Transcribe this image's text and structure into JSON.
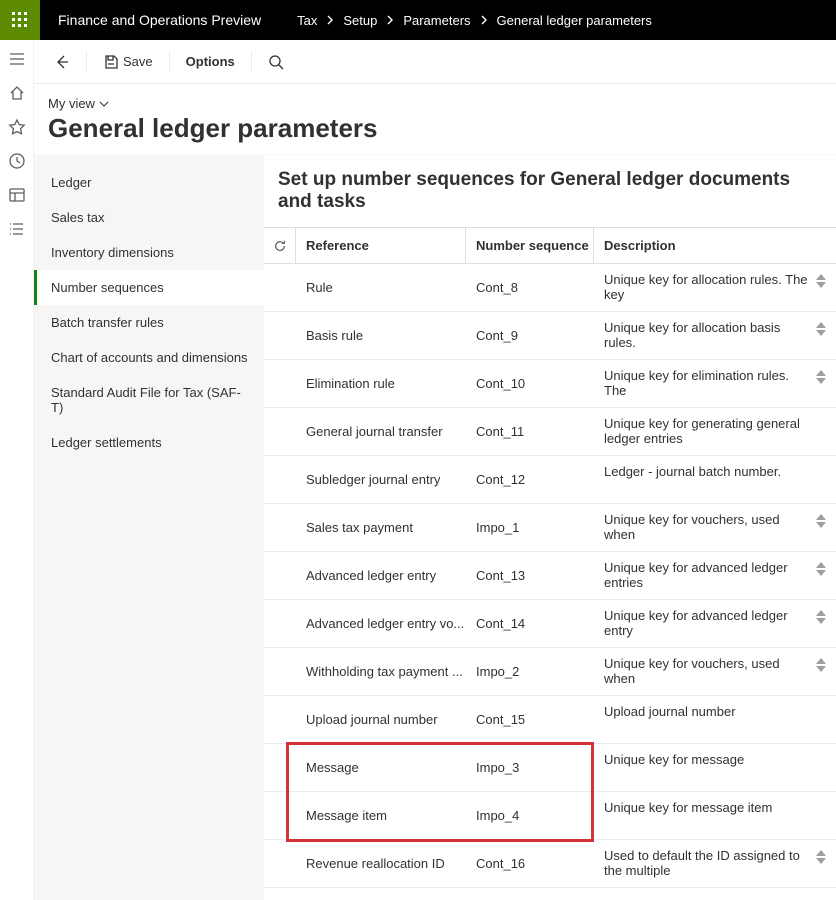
{
  "brand": "Finance and Operations Preview",
  "breadcrumbs": [
    "Tax",
    "Setup",
    "Parameters",
    "General ledger parameters"
  ],
  "toolbar": {
    "save_label": "Save",
    "options_label": "Options"
  },
  "view_picker_label": "My view",
  "page_title": "General ledger parameters",
  "sidebar": {
    "items": [
      {
        "label": "Ledger"
      },
      {
        "label": "Sales tax"
      },
      {
        "label": "Inventory dimensions"
      },
      {
        "label": "Number sequences"
      },
      {
        "label": "Batch transfer rules"
      },
      {
        "label": "Chart of accounts and dimensions"
      },
      {
        "label": "Standard Audit File for Tax (SAF-T)"
      },
      {
        "label": "Ledger settlements"
      }
    ],
    "active_index": 3
  },
  "content": {
    "heading": "Set up number sequences for General ledger documents and tasks",
    "columns": {
      "reference": "Reference",
      "number_sequence": "Number sequence ...",
      "description": "Description"
    },
    "rows": [
      {
        "reference": "Rule",
        "code": "Cont_8",
        "description": "Unique key for allocation rules. The key",
        "spinner": true
      },
      {
        "reference": "Basis rule",
        "code": "Cont_9",
        "description": "Unique key for allocation basis rules.",
        "spinner": true
      },
      {
        "reference": "Elimination rule",
        "code": "Cont_10",
        "description": "Unique key for elimination rules. The",
        "spinner": true
      },
      {
        "reference": "General journal transfer",
        "code": "Cont_11",
        "description": "Unique key for generating general ledger entries",
        "spinner": false
      },
      {
        "reference": "Subledger journal entry",
        "code": "Cont_12",
        "description": "Ledger - journal batch number.",
        "spinner": false
      },
      {
        "reference": "Sales tax payment",
        "code": "Impo_1",
        "description": "Unique key for vouchers, used when",
        "spinner": true
      },
      {
        "reference": "Advanced ledger entry",
        "code": "Cont_13",
        "description": "Unique key for advanced ledger entries",
        "spinner": true
      },
      {
        "reference": "Advanced ledger entry vo...",
        "code": "Cont_14",
        "description": "Unique key for advanced ledger entry",
        "spinner": true
      },
      {
        "reference": "Withholding tax payment ...",
        "code": "Impo_2",
        "description": "Unique key for vouchers, used when",
        "spinner": true
      },
      {
        "reference": "Upload journal number",
        "code": "Cont_15",
        "description": "Upload journal number",
        "spinner": false
      },
      {
        "reference": "Message",
        "code": "Impo_3",
        "description": "Unique key for message",
        "spinner": false,
        "highlight": true
      },
      {
        "reference": "Message item",
        "code": "Impo_4",
        "description": "Unique key for message item",
        "spinner": false,
        "highlight": true
      },
      {
        "reference": "Revenue reallocation ID",
        "code": "Cont_16",
        "description": "Used to default the ID assigned to the multiple",
        "spinner": true
      }
    ]
  }
}
